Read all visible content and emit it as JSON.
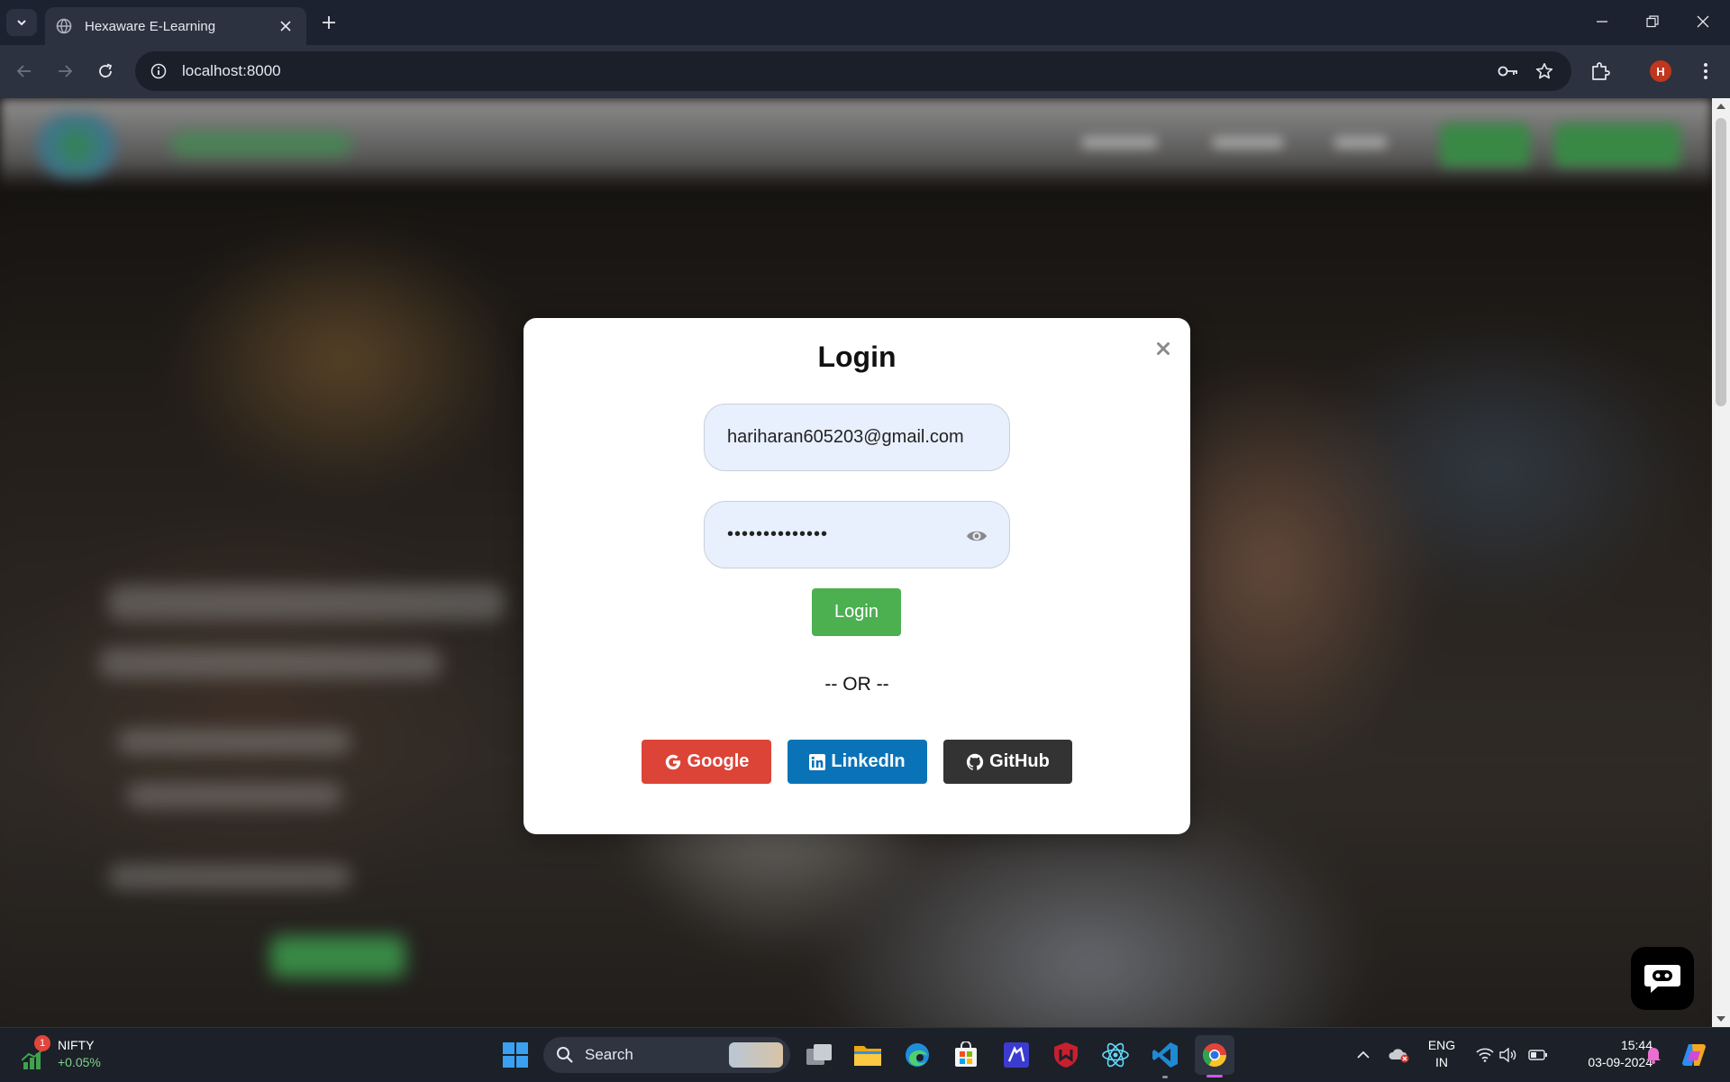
{
  "browser": {
    "tab_title": "Hexaware E-Learning",
    "url": "localhost:8000",
    "profile_initial": "H"
  },
  "modal": {
    "title": "Login",
    "email_value": "hariharan605203@gmail.com",
    "password_mask": "••••••••••••••",
    "login_label": "Login",
    "or_text": "-- OR --",
    "google_label": "Google",
    "linkedin_label": "LinkedIn",
    "github_label": "GitHub",
    "colors": {
      "login": "#4caf50",
      "google": "#dc4437",
      "linkedin": "#0a73b7",
      "github": "#333333"
    }
  },
  "taskbar": {
    "widget_name": "NIFTY",
    "widget_change": "+0.05%",
    "widget_badge": "1",
    "search_label": "Search",
    "lang_line1": "ENG",
    "lang_line2": "IN",
    "time": "15:44",
    "date": "03-09-2024"
  }
}
